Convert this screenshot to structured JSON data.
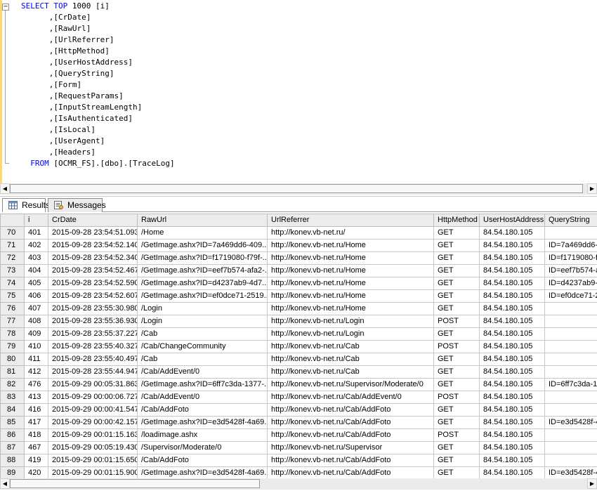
{
  "query": {
    "select_kw": "SELECT",
    "top_kw": "TOP",
    "top_value": "1000",
    "first_col": "[i]",
    "columns": [
      ",[CrDate]",
      ",[RawUrl]",
      ",[UrlReferrer]",
      ",[HttpMethod]",
      ",[UserHostAddress]",
      ",[QueryString]",
      ",[Form]",
      ",[RequestParams]",
      ",[InputStreamLength]",
      ",[IsAuthenticated]",
      ",[IsLocal]",
      ",[UserAgent]",
      ",[Headers]"
    ],
    "from_kw": "FROM",
    "table_ref": "[OCMR_FS].[dbo].[TraceLog]"
  },
  "tabs": {
    "results": "Results",
    "messages": "Messages"
  },
  "grid": {
    "headers": [
      "i",
      "CrDate",
      "RawUrl",
      "UrlReferrer",
      "HttpMethod",
      "UserHostAddress",
      "QueryString"
    ],
    "rows": [
      {
        "n": "70",
        "i": "401",
        "date": "2015-09-28 23:54:51.093",
        "raw": "/Home",
        "ref": "http://konev.vb-net.ru/",
        "method": "GET",
        "ip": "84.54.180.105",
        "qs": ""
      },
      {
        "n": "71",
        "i": "402",
        "date": "2015-09-28 23:54:52.140",
        "raw": "/GetImage.ashx?ID=7a469dd6-409...",
        "ref": "http://konev.vb-net.ru/Home",
        "method": "GET",
        "ip": "84.54.180.105",
        "qs": "ID=7a469dd6-"
      },
      {
        "n": "72",
        "i": "403",
        "date": "2015-09-28 23:54:52.340",
        "raw": "/GetImage.ashx?ID=f1719080-f79f-...",
        "ref": "http://konev.vb-net.ru/Home",
        "method": "GET",
        "ip": "84.54.180.105",
        "qs": "ID=f1719080-f"
      },
      {
        "n": "73",
        "i": "404",
        "date": "2015-09-28 23:54:52.467",
        "raw": "/GetImage.ashx?ID=eef7b574-afa2-...",
        "ref": "http://konev.vb-net.ru/Home",
        "method": "GET",
        "ip": "84.54.180.105",
        "qs": "ID=eef7b574-a"
      },
      {
        "n": "74",
        "i": "405",
        "date": "2015-09-28 23:54:52.590",
        "raw": "/GetImage.ashx?ID=d4237ab9-4d7...",
        "ref": "http://konev.vb-net.ru/Home",
        "method": "GET",
        "ip": "84.54.180.105",
        "qs": "ID=d4237ab9-"
      },
      {
        "n": "75",
        "i": "406",
        "date": "2015-09-28 23:54:52.607",
        "raw": "/GetImage.ashx?ID=ef0dce71-2519...",
        "ref": "http://konev.vb-net.ru/Home",
        "method": "GET",
        "ip": "84.54.180.105",
        "qs": "ID=ef0dce71-2"
      },
      {
        "n": "76",
        "i": "407",
        "date": "2015-09-28 23:55:30.980",
        "raw": "/Login",
        "ref": "http://konev.vb-net.ru/Home",
        "method": "GET",
        "ip": "84.54.180.105",
        "qs": ""
      },
      {
        "n": "77",
        "i": "408",
        "date": "2015-09-28 23:55:36.930",
        "raw": "/Login",
        "ref": "http://konev.vb-net.ru/Login",
        "method": "POST",
        "ip": "84.54.180.105",
        "qs": ""
      },
      {
        "n": "78",
        "i": "409",
        "date": "2015-09-28 23:55:37.227",
        "raw": "/Cab",
        "ref": "http://konev.vb-net.ru/Login",
        "method": "GET",
        "ip": "84.54.180.105",
        "qs": ""
      },
      {
        "n": "79",
        "i": "410",
        "date": "2015-09-28 23:55:40.327",
        "raw": "/Cab/ChangeCommunity",
        "ref": "http://konev.vb-net.ru/Cab",
        "method": "POST",
        "ip": "84.54.180.105",
        "qs": ""
      },
      {
        "n": "80",
        "i": "411",
        "date": "2015-09-28 23:55:40.497",
        "raw": "/Cab",
        "ref": "http://konev.vb-net.ru/Cab",
        "method": "GET",
        "ip": "84.54.180.105",
        "qs": ""
      },
      {
        "n": "81",
        "i": "412",
        "date": "2015-09-28 23:55:44.947",
        "raw": "/Cab/AddEvent/0",
        "ref": "http://konev.vb-net.ru/Cab",
        "method": "GET",
        "ip": "84.54.180.105",
        "qs": ""
      },
      {
        "n": "82",
        "i": "476",
        "date": "2015-09-29 00:05:31.863",
        "raw": "/GetImage.ashx?ID=6ff7c3da-1377-...",
        "ref": "http://konev.vb-net.ru/Supervisor/Moderate/0",
        "method": "GET",
        "ip": "84.54.180.105",
        "qs": "ID=6ff7c3da-1"
      },
      {
        "n": "83",
        "i": "413",
        "date": "2015-09-29 00:00:06.727",
        "raw": "/Cab/AddEvent/0",
        "ref": "http://konev.vb-net.ru/Cab/AddEvent/0",
        "method": "POST",
        "ip": "84.54.180.105",
        "qs": ""
      },
      {
        "n": "84",
        "i": "416",
        "date": "2015-09-29 00:00:41.547",
        "raw": "/Cab/AddFoto",
        "ref": "http://konev.vb-net.ru/Cab/AddFoto",
        "method": "GET",
        "ip": "84.54.180.105",
        "qs": ""
      },
      {
        "n": "85",
        "i": "417",
        "date": "2015-09-29 00:00:42.157",
        "raw": "/GetImage.ashx?ID=e3d5428f-4a69...",
        "ref": "http://konev.vb-net.ru/Cab/AddFoto",
        "method": "GET",
        "ip": "84.54.180.105",
        "qs": "ID=e3d5428f-4"
      },
      {
        "n": "86",
        "i": "418",
        "date": "2015-09-29 00:01:15.163",
        "raw": "/loadimage.ashx",
        "ref": "http://konev.vb-net.ru/Cab/AddFoto",
        "method": "POST",
        "ip": "84.54.180.105",
        "qs": ""
      },
      {
        "n": "87",
        "i": "467",
        "date": "2015-09-29 00:05:19.430",
        "raw": "/Supervisor/Moderate/0",
        "ref": "http://konev.vb-net.ru/Supervisor",
        "method": "GET",
        "ip": "84.54.180.105",
        "qs": ""
      },
      {
        "n": "88",
        "i": "419",
        "date": "2015-09-29 00:01:15.650",
        "raw": "/Cab/AddFoto",
        "ref": "http://konev.vb-net.ru/Cab/AddFoto",
        "method": "GET",
        "ip": "84.54.180.105",
        "qs": ""
      },
      {
        "n": "89",
        "i": "420",
        "date": "2015-09-29 00:01:15.900",
        "raw": "/GetImage.ashx?ID=e3d5428f-4a69...",
        "ref": "http://konev.vb-net.ru/Cab/AddFoto",
        "method": "GET",
        "ip": "84.54.180.105",
        "qs": "ID=e3d5428f-4"
      }
    ]
  },
  "colors": {
    "keyword": "#0000ff",
    "punct": "#808080",
    "gutter": "#ffd86b",
    "header_bg": "#ececec"
  }
}
